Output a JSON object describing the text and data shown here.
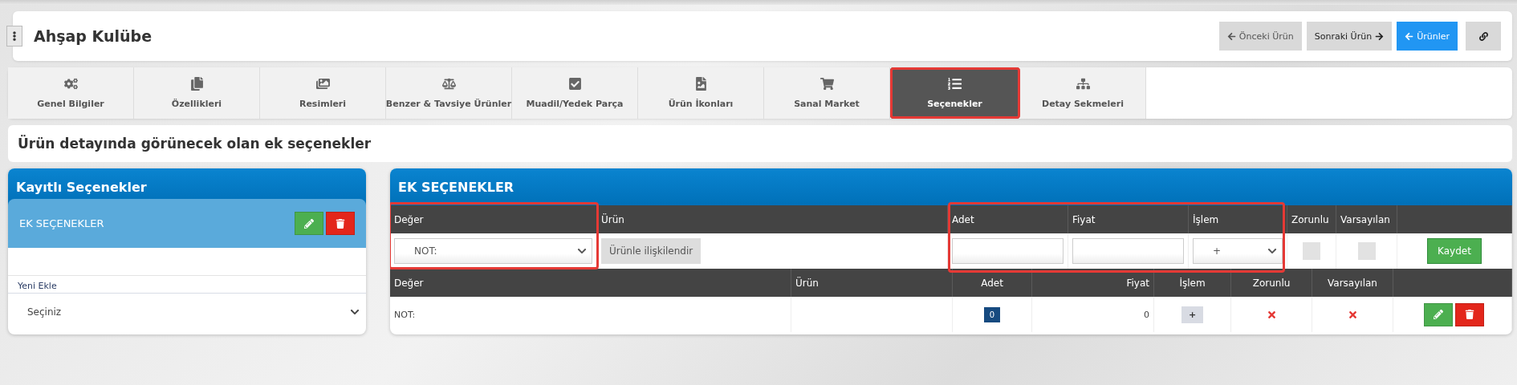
{
  "header": {
    "title": "Ahşap Kulübe",
    "buttons": [
      {
        "label": "Önceki Ürün",
        "kind": "prev"
      },
      {
        "label": "Sonraki Ürün",
        "kind": "next"
      },
      {
        "label": "Ürünler",
        "kind": "primary"
      },
      {
        "kind": "link"
      }
    ]
  },
  "tabs": [
    {
      "label": "Genel Bilgiler",
      "selected": false
    },
    {
      "label": "Özellikleri",
      "selected": false
    },
    {
      "label": "Resimleri",
      "selected": false
    },
    {
      "label": "Benzer & Tavsiye Ürünler",
      "selected": false
    },
    {
      "label": "Muadil/Yedek Parça",
      "selected": false
    },
    {
      "label": "Ürün İkonları",
      "selected": false
    },
    {
      "label": "Sanal Market",
      "selected": false
    },
    {
      "label": "Seçenekler",
      "selected": true
    },
    {
      "label": "Detay Sekmeleri",
      "selected": false
    }
  ],
  "subtitle": "Ürün detayında görünecek olan ek seçenekler",
  "saved_panel": {
    "title": "Kayıtlı Seçenekler",
    "items": [
      {
        "name": "EK SEÇENEKLER"
      }
    ],
    "add_label": "Yeni Ekle",
    "add_select": "Seçiniz"
  },
  "options_panel": {
    "title": "EK SEÇENEKLER",
    "form": {
      "columns": [
        "Değer",
        "Ürün",
        "Adet",
        "Fiyat",
        "İşlem",
        "Zorunlu",
        "Varsayılan"
      ],
      "value_select": "NOT:",
      "link_button": "Ürünle ilişkilendir",
      "operation_select": "+",
      "required": false,
      "default": false,
      "save_button": "Kaydet"
    },
    "table": {
      "columns": [
        "Değer",
        "Ürün",
        "Adet",
        "Fiyat",
        "İşlem",
        "Zorunlu",
        "Varsayılan"
      ],
      "rows": [
        {
          "value": "NOT:",
          "quantity": "0",
          "price": "0",
          "operation": "+",
          "required": false,
          "default": false
        }
      ]
    }
  }
}
